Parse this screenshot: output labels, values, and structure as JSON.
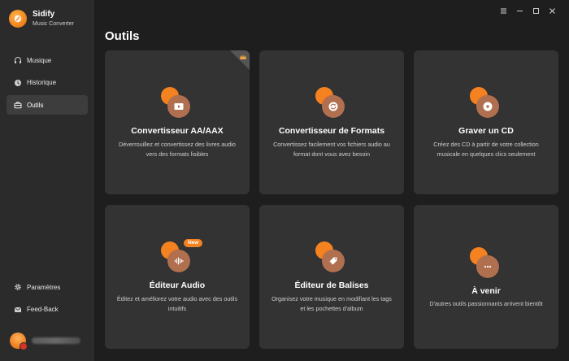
{
  "app": {
    "name": "Sidify",
    "subtitle": "Music Converter"
  },
  "sidebar": {
    "items": [
      {
        "label": "Musique",
        "icon": "headphones-icon"
      },
      {
        "label": "Historique",
        "icon": "clock-icon"
      },
      {
        "label": "Outils",
        "icon": "toolbox-icon",
        "active": true
      }
    ],
    "bottom": [
      {
        "label": "Paramètres",
        "icon": "gear-icon"
      },
      {
        "label": "Feed-Back",
        "icon": "mail-icon"
      }
    ]
  },
  "page": {
    "title": "Outils"
  },
  "cards": [
    {
      "title": "Convertisseur AA/AAX",
      "desc": "Déverrouillez et convertissez des livres audio vers des formats lisibles",
      "icon": "play-video-icon"
    },
    {
      "title": "Convertisseur de Formats",
      "desc": "Convertissez facilement vos fichiers audio au format dont vous avez besoin",
      "icon": "refresh-icon"
    },
    {
      "title": "Graver un CD",
      "desc": "Créez des CD à partir de votre collection musicale en quelques clics seulement",
      "icon": "disc-icon"
    },
    {
      "title": "Éditeur Audio",
      "desc": "Éditez et améliorez votre audio avec des outils intuitifs",
      "icon": "waveform-icon",
      "badge": "New"
    },
    {
      "title": "Éditeur de Balises",
      "desc": "Organisez votre musique en modifiant les tags et les pochettes d'album",
      "icon": "tag-icon"
    },
    {
      "title": "À venir",
      "desc": "D'autres outils passionnants arrivent bientôt",
      "icon": "more-icon"
    }
  ],
  "colors": {
    "accent": "#f58220",
    "card": "#333333",
    "sidebar": "#2b2b2b",
    "background": "#1e1e1e"
  }
}
